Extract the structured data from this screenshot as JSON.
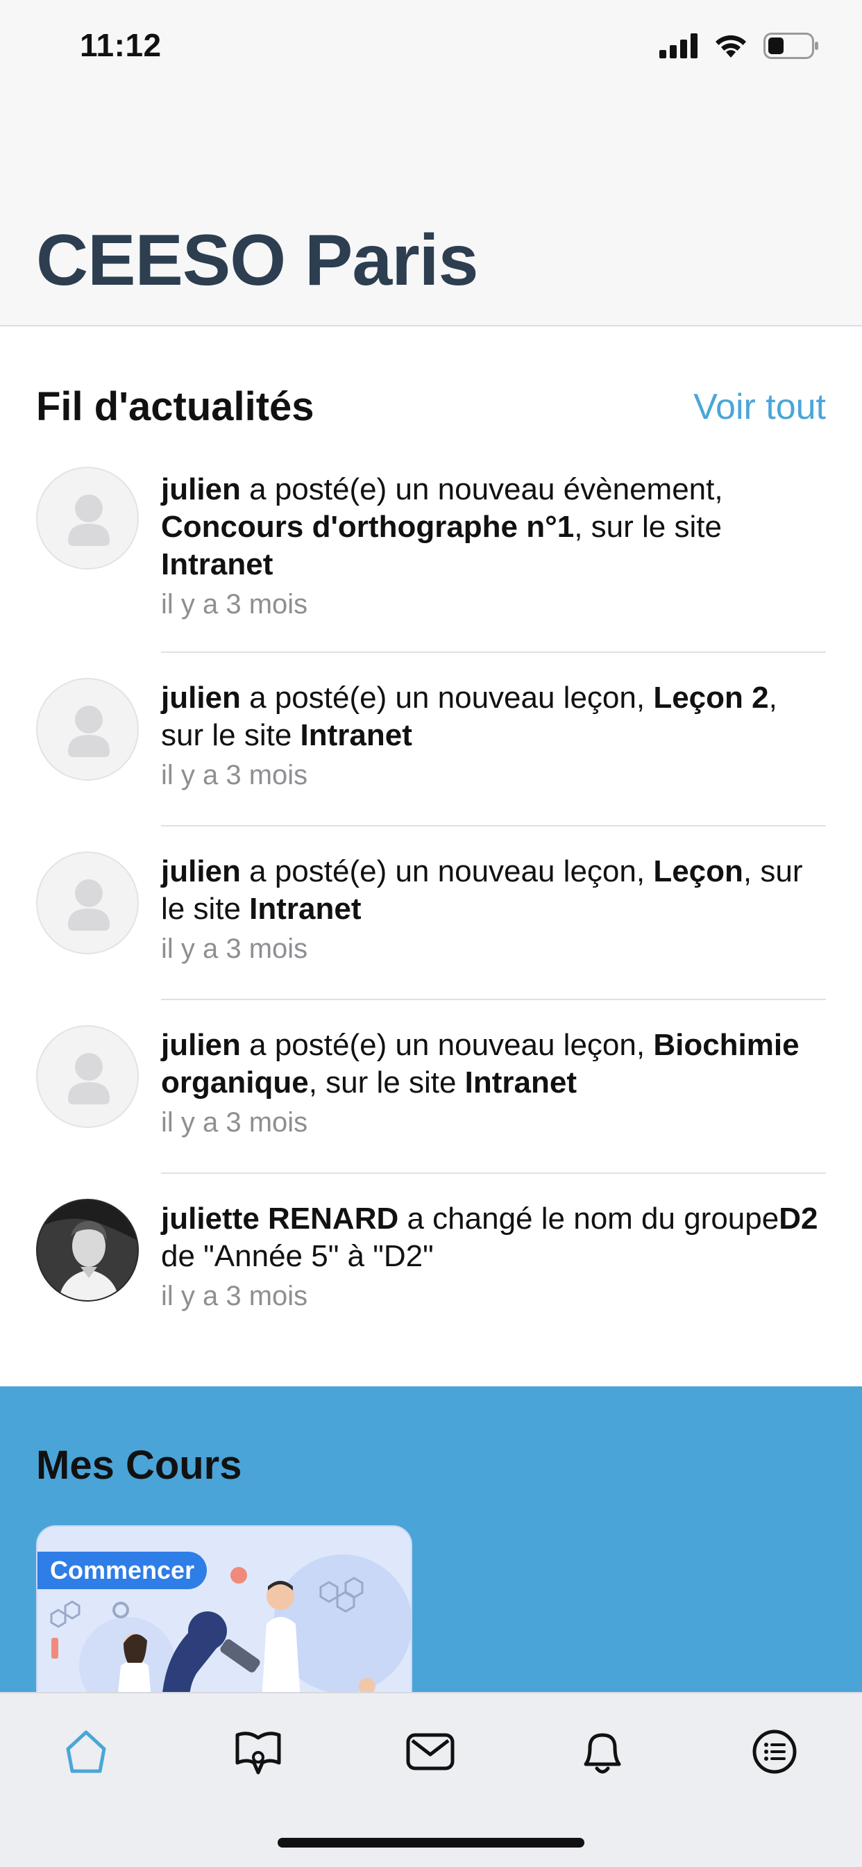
{
  "status_bar": {
    "time": "11:12"
  },
  "header": {
    "title": "CEESO Paris"
  },
  "news": {
    "title": "Fil d'actualités",
    "see_all": "Voir tout",
    "items": [
      {
        "user": "julien",
        "action": " a posté(e) un nouveau évènement, ",
        "object": "Concours d'orthographe n°1",
        "mid": ", sur le site ",
        "site": "Intranet",
        "time": "il y a 3 mois",
        "avatar": "placeholder"
      },
      {
        "user": "julien",
        "action": " a posté(e) un nouveau leçon, ",
        "object": "Leçon 2",
        "mid": ", sur le site ",
        "site": "Intranet",
        "time": "il y a 3 mois",
        "avatar": "placeholder"
      },
      {
        "user": "julien",
        "action": " a posté(e) un nouveau leçon, ",
        "object": "Leçon",
        "mid": ", sur le site ",
        "site": "Intranet",
        "time": "il y a 3 mois",
        "avatar": "placeholder"
      },
      {
        "user": "julien",
        "action": " a posté(e) un nouveau leçon, ",
        "object": "Biochimie organique",
        "mid": ", sur le site ",
        "site": "Intranet",
        "time": "il y a 3 mois",
        "avatar": "placeholder"
      },
      {
        "user": "juliette RENARD",
        "action": " a changé le nom du groupe",
        "object": "D2",
        "mid": " de \"Année 5\" à \"D2\"",
        "site": "",
        "time": "il y a 3 mois",
        "avatar": "photo"
      }
    ]
  },
  "courses": {
    "title": "Mes Cours",
    "cards": [
      {
        "badge": "Commencer"
      }
    ]
  },
  "tabbar": {
    "tabs": [
      {
        "name": "home",
        "active": true
      },
      {
        "name": "courses"
      },
      {
        "name": "messages"
      },
      {
        "name": "notifications"
      },
      {
        "name": "menu"
      }
    ],
    "active_color": "#4aa6d8",
    "icon_color": "#111111"
  },
  "colors": {
    "accent": "#4aa6d8",
    "title": "#2c3e50",
    "courses_bg": "#4ba4d8",
    "badge": "#2f7de6"
  }
}
